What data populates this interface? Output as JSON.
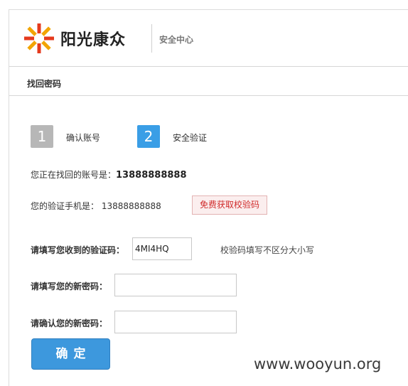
{
  "header": {
    "brand": "阳光康众",
    "subtitle": "安全中心"
  },
  "breadcrumb": "找回密码",
  "steps": [
    {
      "number": "1",
      "label": "确认账号"
    },
    {
      "number": "2",
      "label": "安全验证"
    }
  ],
  "account": {
    "prefix": "您正在找回的账号是：",
    "value": "13888888888"
  },
  "phone": {
    "label": "您的验证手机是：  13888888888",
    "sms_button": "免费获取校验码"
  },
  "form": {
    "code_label": "请填写您收到的验证码：",
    "code_value": "4MI4HQ",
    "code_hint": "校验码填写不区分大小写",
    "new_password_label": "请填写您的新密码：",
    "confirm_password_label": "请确认您的新密码：",
    "submit_label": "确定"
  },
  "watermark": "www.wooyun.org",
  "colors": {
    "accent": "#3d98dd",
    "step_active": "#3a9ee6",
    "step_inactive": "#b7b7b7",
    "sms_text": "#d02b2b"
  }
}
